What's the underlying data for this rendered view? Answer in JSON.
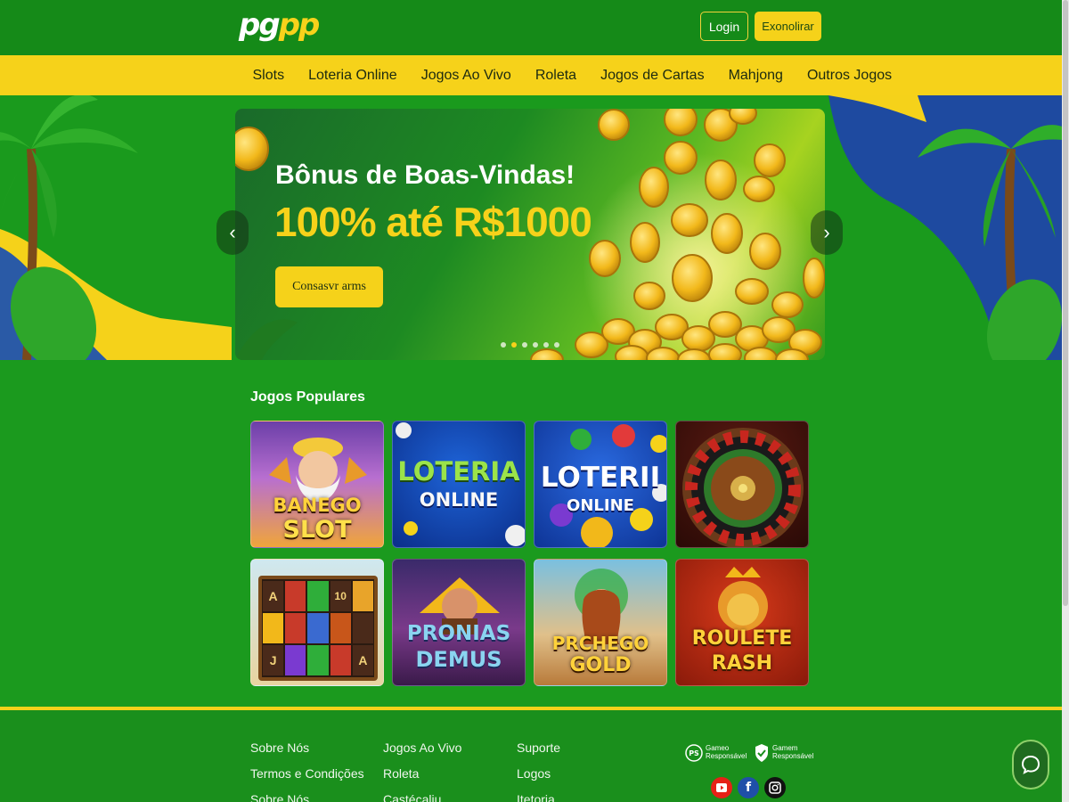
{
  "header": {
    "logo_left": "pg",
    "logo_right": "pp",
    "login_label": "Login",
    "register_label": "Exonolirar"
  },
  "nav": {
    "items": [
      "Slots",
      "Loteria Online",
      "Jogos Ao Vivo",
      "Roleta",
      "Jogos de Cartas",
      "Mahjong",
      "Outros Jogos"
    ]
  },
  "banner": {
    "title": "Bônus de Boas-Vindas!",
    "amount": "100% até R$1000",
    "cta_label": "Consasvr arms",
    "prev_icon": "chevron-left-icon",
    "next_icon": "chevron-right-icon",
    "slide_count": 6,
    "active_slide": 2
  },
  "popular": {
    "title": "Jogos Populares",
    "games": [
      {
        "line1": "BANEGO",
        "line2": "SLOT",
        "theme": "zeus"
      },
      {
        "line1": "LOTERIA",
        "line2": "ONLINE",
        "theme": "lottery-blue"
      },
      {
        "line1": "LOTERII",
        "line2": "ONLINE",
        "theme": "lottery-balls"
      },
      {
        "line1": "",
        "line2": "",
        "theme": "roulette-wheel"
      },
      {
        "line1": "",
        "line2": "",
        "theme": "slot-reels"
      },
      {
        "line1": "PRONIAS",
        "line2": "DEMUS",
        "theme": "warrior"
      },
      {
        "line1": "PRCHEGO",
        "line2": "GOLD",
        "theme": "goddess"
      },
      {
        "line1": "ROULETE",
        "line2": "RASH",
        "theme": "lion"
      }
    ],
    "reel_symbols": [
      "A",
      "",
      "",
      "10",
      "",
      "",
      "",
      "",
      "",
      "",
      "J",
      "",
      "",
      "",
      "A"
    ]
  },
  "footer": {
    "col1": [
      "Sobre Nós",
      "Termos e Condições",
      "Sobre Nós"
    ],
    "col2": [
      "Jogos Ao Vivo",
      "Roleta",
      "Castécaliu"
    ],
    "col3": [
      "Suporte",
      "Logos",
      "Itetoria"
    ],
    "badge1": {
      "line1": "Gameo",
      "line2": "Responsável"
    },
    "badge2": {
      "line1": "Gamem",
      "line2": "Responsável"
    },
    "social": [
      "youtube-icon",
      "facebook-icon",
      "instagram-icon"
    ]
  },
  "colors": {
    "green": "#1b9a1e",
    "yellow": "#f6d21a",
    "dark_green": "#158a18"
  }
}
